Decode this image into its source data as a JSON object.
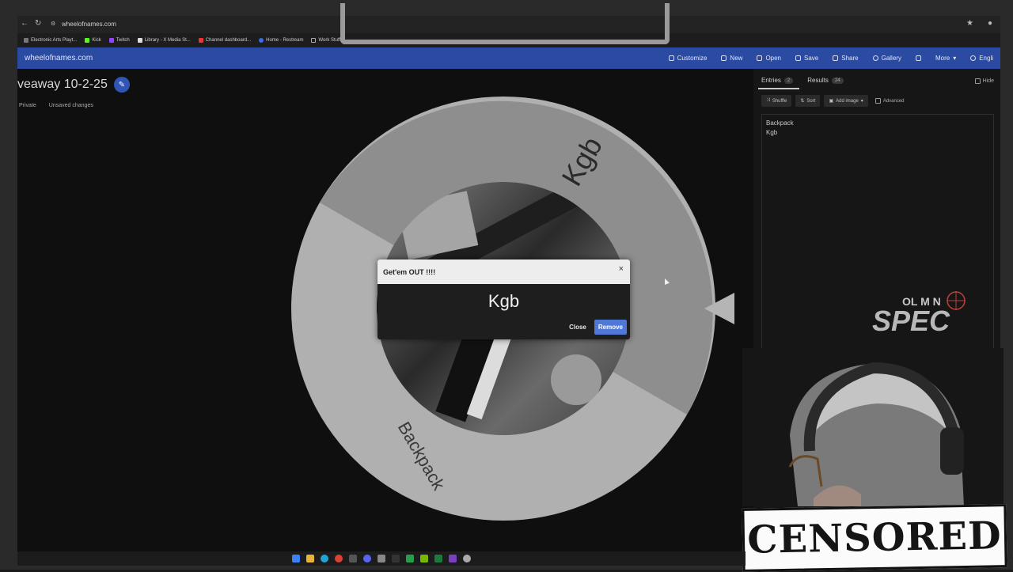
{
  "browser": {
    "url": "wheelofnames.com",
    "bookmarks": [
      "Electronic Arts Playt...",
      "Kick",
      "Twitch",
      "Library - X Media St...",
      "Channel dashboard...",
      "Home - Restream",
      "Work Stuff"
    ]
  },
  "header": {
    "site": "wheelofnames.com",
    "menu": [
      "Customize",
      "New",
      "Open",
      "Save",
      "Share",
      "Gallery",
      "More",
      "Engli"
    ]
  },
  "wheel": {
    "title": "veaway 10-2-25",
    "status": [
      "Private",
      "Unsaved changes"
    ],
    "segments": [
      "Kgb",
      "Backpack"
    ]
  },
  "dialog": {
    "title": "Get'em OUT !!!!",
    "close_glyph": "×",
    "winner": "Kgb",
    "close_label": "Close",
    "remove_label": "Remove"
  },
  "sidebar": {
    "tabs": [
      {
        "label": "Entries",
        "count": "2"
      },
      {
        "label": "Results",
        "count": "24"
      }
    ],
    "hide_label": "Hide",
    "toolbar": [
      "Shuffle",
      "Sort",
      "Add image"
    ],
    "advanced_label": "Advanced",
    "entries": [
      "Backpack",
      "Kgb"
    ]
  },
  "overlay": {
    "logo_top": "OL M N",
    "logo_main": "SPEC",
    "censored": "CENSORED"
  },
  "colors": {
    "appbar": "#2b4aa2",
    "remove_button": "#4f78d8",
    "segment_kgb": "#8e8e8e",
    "segment_backpack": "#b0b0b0"
  }
}
